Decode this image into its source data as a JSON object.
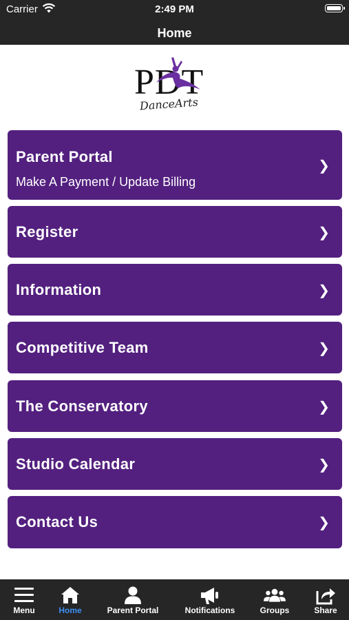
{
  "status_bar": {
    "carrier": "Carrier",
    "time": "2:49 PM"
  },
  "nav": {
    "title": "Home"
  },
  "logo": {
    "text": "PDT",
    "script": "DanceArts"
  },
  "menu": [
    {
      "label": "Parent Portal",
      "sublabel": "Make A Payment / Update Billing",
      "chevron": "❯"
    },
    {
      "label": "Register",
      "chevron": "❯"
    },
    {
      "label": "Information",
      "chevron": "❯"
    },
    {
      "label": "Competitive Team",
      "chevron": "❯"
    },
    {
      "label": "The Conservatory",
      "chevron": "❯"
    },
    {
      "label": "Studio Calendar",
      "chevron": "❯"
    },
    {
      "label": "Contact Us",
      "chevron": "❯"
    }
  ],
  "tabs": [
    {
      "label": "Menu",
      "icon": "hamburger-icon",
      "active": false
    },
    {
      "label": "Home",
      "icon": "home-icon",
      "active": true
    },
    {
      "label": "Parent Portal",
      "icon": "person-icon",
      "active": false
    },
    {
      "label": "Notifications",
      "icon": "megaphone-icon",
      "active": false
    },
    {
      "label": "Groups",
      "icon": "group-icon",
      "active": false
    },
    {
      "label": "Share",
      "icon": "share-icon",
      "active": false
    }
  ],
  "colors": {
    "bar": "#262626",
    "button": "#53207f",
    "active_tab": "#3d8ff2"
  }
}
